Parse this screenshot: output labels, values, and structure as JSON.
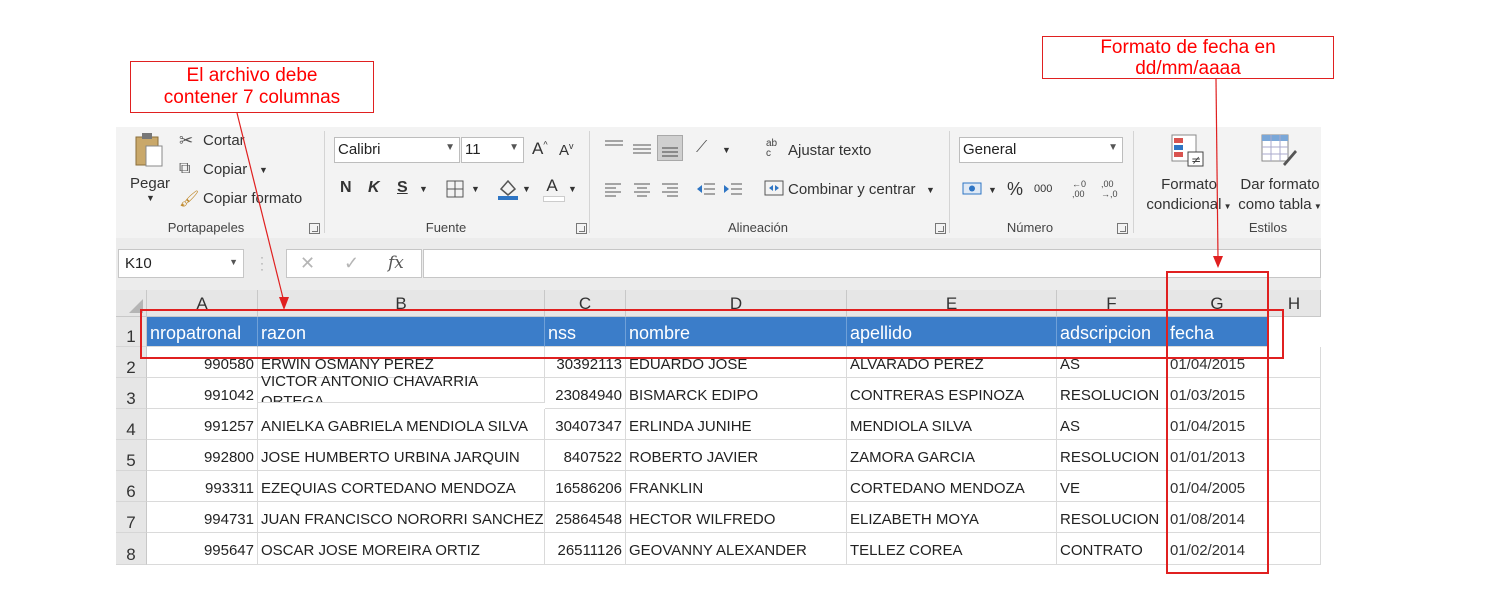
{
  "annotations": {
    "left_callout": [
      "El archivo debe",
      "contener 7 columnas"
    ],
    "right_callout": [
      "Formato de fecha en",
      "dd/mm/aaaa"
    ]
  },
  "ribbon": {
    "portapapeles": {
      "paste": "Pegar",
      "cut": "Cortar",
      "copy": "Copiar",
      "format_painter": "Copiar formato",
      "label": "Portapapeles"
    },
    "fuente": {
      "font_name": "Calibri",
      "font_size": "11",
      "bold": "N",
      "italic": "K",
      "underline": "S",
      "grow": "A",
      "shrink": "A",
      "font_color": "A",
      "label": "Fuente"
    },
    "alineacion": {
      "wrap": "Ajustar texto",
      "merge": "Combinar y centrar",
      "label": "Alineación",
      "wrap_icon_text": "ab c"
    },
    "numero": {
      "format": "General",
      "percent": "%",
      "thousands": "000",
      "label": "Número"
    },
    "estilos": {
      "conditional_1": "Formato",
      "conditional_2": "condicional",
      "table_1": "Dar formato",
      "table_2": "como tabla",
      "label": "Estilos"
    }
  },
  "formula_bar": {
    "name_box": "K10",
    "fx": "fx",
    "value": ""
  },
  "sheet": {
    "columns": [
      "A",
      "B",
      "C",
      "D",
      "E",
      "F",
      "G",
      "H"
    ],
    "row_numbers": [
      "1",
      "2",
      "3",
      "4",
      "5",
      "6",
      "7",
      "8"
    ],
    "headers": [
      "nropatronal",
      "razon",
      "nss",
      "nombre",
      "apellido",
      "adscripcion",
      "fecha"
    ],
    "rows": [
      [
        "990580",
        "ERWIN OSMANY PEREZ",
        "30392113",
        "EDUARDO JOSE",
        "ALVARADO PEREZ",
        "AS",
        "01/04/2015"
      ],
      [
        "991042",
        "VICTOR ANTONIO CHAVARRIA ORTEGA",
        "23084940",
        "BISMARCK EDIPO",
        "CONTRERAS ESPINOZA",
        "RESOLUCION",
        "01/03/2015"
      ],
      [
        "991257",
        "ANIELKA GABRIELA MENDIOLA SILVA",
        "30407347",
        "ERLINDA JUNIHE",
        "MENDIOLA SILVA",
        "AS",
        "01/04/2015"
      ],
      [
        "992800",
        "JOSE HUMBERTO URBINA JARQUIN",
        "8407522",
        "ROBERTO JAVIER",
        "ZAMORA GARCIA",
        "RESOLUCION",
        "01/01/2013"
      ],
      [
        "993311",
        "EZEQUIAS CORTEDANO MENDOZA",
        "16586206",
        "FRANKLIN",
        "CORTEDANO MENDOZA",
        "VE",
        "01/04/2005"
      ],
      [
        "994731",
        "JUAN FRANCISCO NORORRI SANCHEZ",
        "25864548",
        "HECTOR WILFREDO",
        "ELIZABETH MOYA",
        "RESOLUCION",
        "01/08/2014"
      ],
      [
        "995647",
        "OSCAR JOSE MOREIRA ORTIZ",
        "26511126",
        "GEOVANNY ALEXANDER",
        "TELLEZ COREA",
        "CONTRATO",
        "01/02/2014"
      ]
    ]
  }
}
